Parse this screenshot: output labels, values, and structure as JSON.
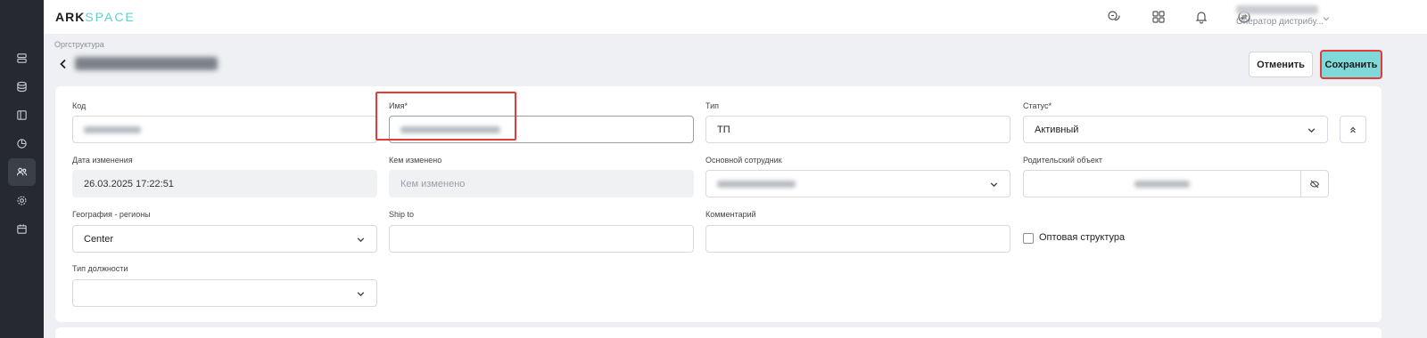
{
  "app": {
    "logo_primary": "ARK",
    "logo_secondary": "SPACE"
  },
  "user": {
    "role": "Оператор дистрибу..."
  },
  "sidebar": {
    "items": [
      {
        "icon": "server-icon",
        "active": false
      },
      {
        "icon": "database-icon",
        "active": false
      },
      {
        "icon": "panel-icon",
        "active": false
      },
      {
        "icon": "pie-chart-icon",
        "active": false
      },
      {
        "icon": "users-icon",
        "active": true
      },
      {
        "icon": "gear-icon",
        "active": false
      },
      {
        "icon": "calendar-icon",
        "active": false
      }
    ]
  },
  "header": {
    "breadcrumb": "Оргструктура",
    "cancel_label": "Отменить",
    "save_label": "Сохранить"
  },
  "form": {
    "code": {
      "label": "Код"
    },
    "name": {
      "label": "Имя*"
    },
    "type": {
      "label": "Тип",
      "value": "ТП"
    },
    "status": {
      "label": "Статус*",
      "value": "Активный"
    },
    "changed_date": {
      "label": "Дата изменения",
      "value": "26.03.2025 17:22:51"
    },
    "changed_by": {
      "label": "Кем изменено",
      "placeholder": "Кем изменено"
    },
    "main_employee": {
      "label": "Основной сотрудник"
    },
    "parent_object": {
      "label": "Родительский объект"
    },
    "geography": {
      "label": "География - регионы",
      "value": "Center"
    },
    "ship_to": {
      "label": "Ship to",
      "value": ""
    },
    "comment": {
      "label": "Комментарий",
      "value": ""
    },
    "wholesale": {
      "label": "Оптовая структура",
      "checked": false
    },
    "position_type": {
      "label": "Тип должности",
      "value": ""
    }
  },
  "colors": {
    "accent": "#7fd9d9",
    "highlight": "#e33b3b",
    "sidebar": "#262a30"
  }
}
